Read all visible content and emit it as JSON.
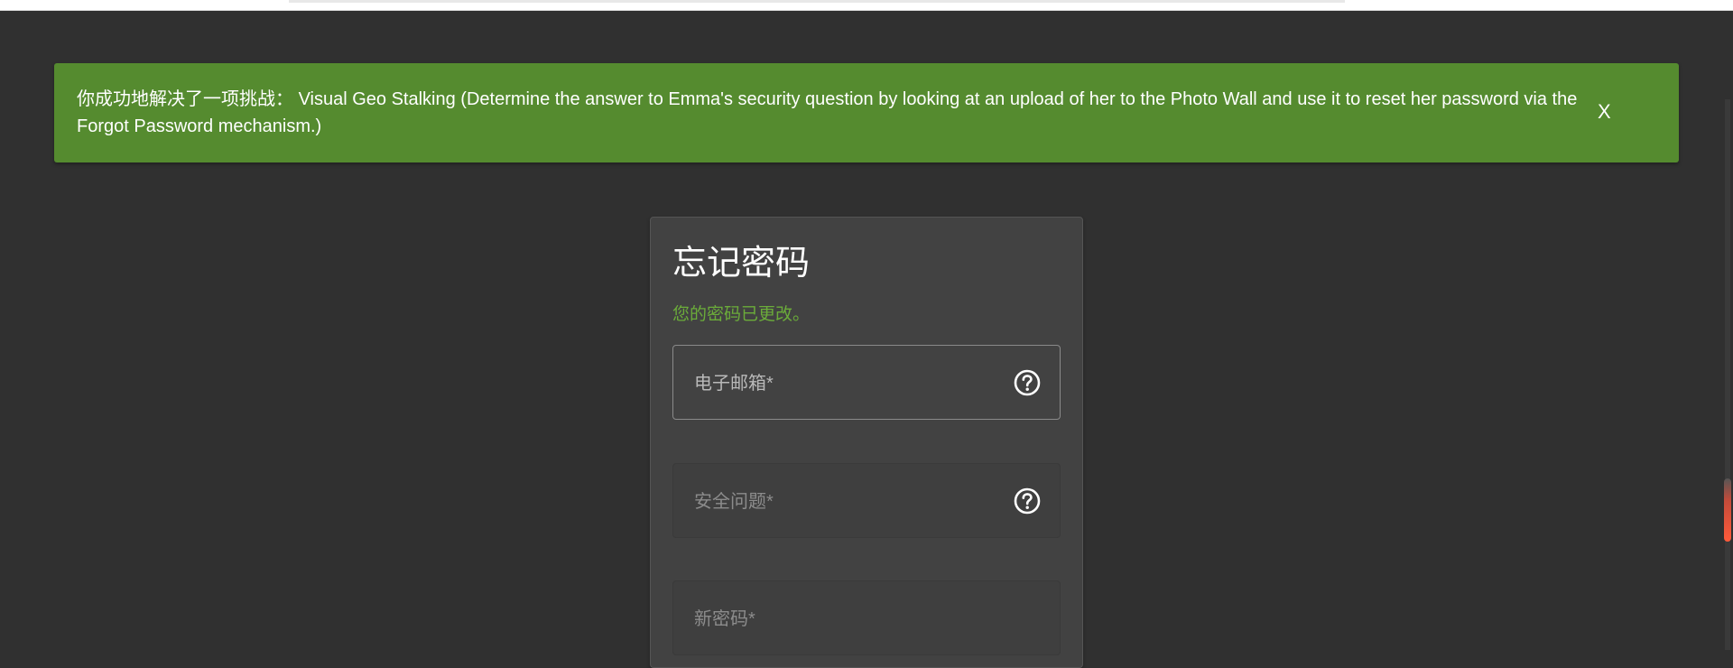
{
  "banner": {
    "message_prefix": "你成功地解决了一项挑战：",
    "message": "Visual Geo Stalking (Determine the answer to Emma's security question by looking at an upload of her to the Photo Wall and use it to reset her password via the Forgot Password mechanism.)",
    "close_label": "X",
    "color": "#558b2f"
  },
  "form": {
    "title": "忘记密码",
    "success_message": "您的密码已更改。",
    "success_color": "#6bac3a",
    "fields": [
      {
        "label": "电子邮箱*",
        "icon": "help-circle-icon"
      },
      {
        "label": "安全问题*",
        "icon": "help-circle-icon"
      },
      {
        "label": "新密码*"
      }
    ]
  }
}
